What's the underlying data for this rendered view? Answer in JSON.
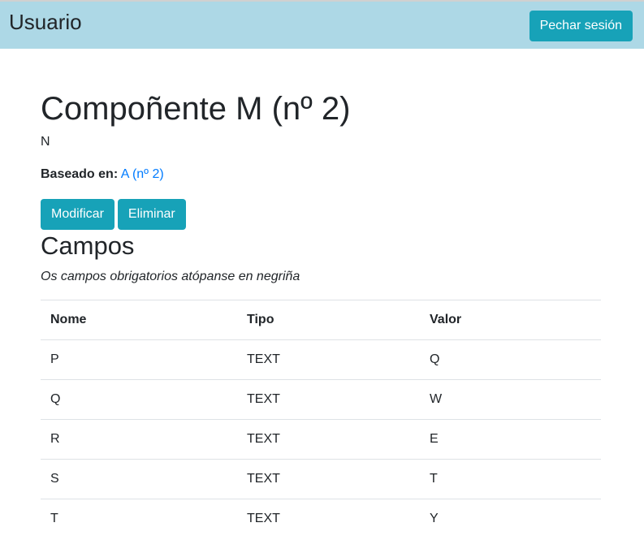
{
  "navbar": {
    "brand": "Usuario",
    "logout_label": "Pechar sesión"
  },
  "component": {
    "title": "Compoñente M (nº 2)",
    "description": "N",
    "based_on_label": "Baseado en:",
    "based_on_link": "A (nº 2)"
  },
  "actions": {
    "modify_label": "Modificar",
    "delete_label": "Eliminar"
  },
  "fields": {
    "title": "Campos",
    "note": "Os campos obrigatorios atópanse en negriña",
    "columns": [
      "Nome",
      "Tipo",
      "Valor"
    ],
    "rows": [
      [
        "P",
        "TEXT",
        "Q"
      ],
      [
        "Q",
        "TEXT",
        "W"
      ],
      [
        "R",
        "TEXT",
        "E"
      ],
      [
        "S",
        "TEXT",
        "T"
      ],
      [
        "T",
        "TEXT",
        "Y"
      ]
    ]
  },
  "colors": {
    "navbar": "#add8e6",
    "button": "#17a2b8",
    "link": "#007bff"
  }
}
